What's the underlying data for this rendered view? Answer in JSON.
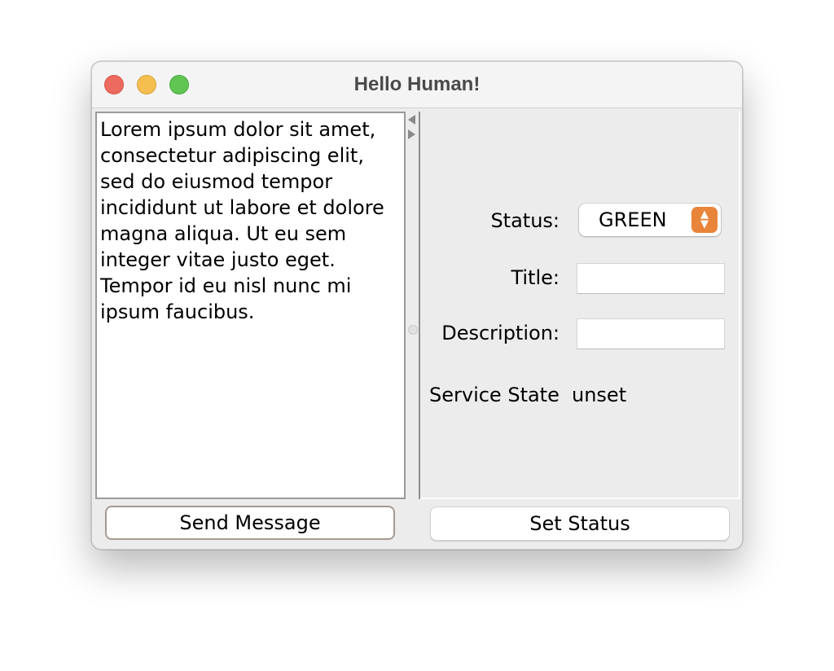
{
  "window": {
    "title": "Hello Human!"
  },
  "message": {
    "text": "Lorem ipsum dolor sit amet,\nconsectetur adipiscing elit,\nsed do eiusmod tempor\nincididunt ut labore et dolore\nmagna aliqua. Ut eu sem\ninteger vitae justo eget.\nTempor id eu nisl nunc mi\nipsum faucibus."
  },
  "form": {
    "status_label": "Status:",
    "status_value": "GREEN",
    "title_label": "Title:",
    "title_value": "",
    "description_label": "Description:",
    "description_value": "",
    "service_state_label": "Service State",
    "service_state_value": "unset"
  },
  "buttons": {
    "send_message": "Send Message",
    "set_status": "Set Status"
  },
  "colors": {
    "close": "#ed6a5e",
    "minimize": "#f5bf4f",
    "maximize": "#61c554",
    "stepper_accent": "#e8853a"
  },
  "icons": {
    "close": "close-icon",
    "minimize": "minimize-icon",
    "maximize": "maximize-icon",
    "stepper": "chevron-up-down-icon",
    "split_left": "arrow-left-icon",
    "split_right": "arrow-right-icon"
  }
}
